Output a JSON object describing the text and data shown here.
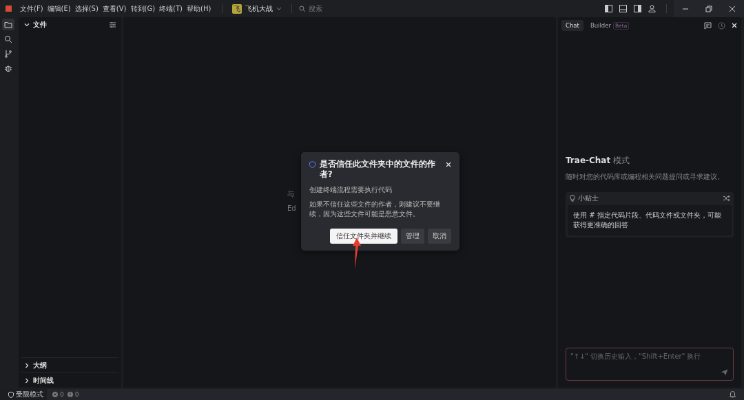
{
  "menu": [
    "文件(F)",
    "编辑(E)",
    "选择(S)",
    "查看(V)",
    "转到(G)",
    "终端(T)",
    "帮助(H)"
  ],
  "project": {
    "initial": "飞",
    "name": "飞机大战"
  },
  "search": {
    "placeholder": "搜索"
  },
  "activity": [
    {
      "kind": "files",
      "selected": true
    },
    {
      "kind": "search",
      "selected": false
    },
    {
      "kind": "branch",
      "selected": false
    },
    {
      "kind": "debug",
      "selected": false
    }
  ],
  "sidebar": {
    "sections": [
      {
        "title": "文件",
        "expanded": true
      },
      {
        "title": "大纲",
        "expanded": false
      },
      {
        "title": "时间线",
        "expanded": false
      }
    ]
  },
  "editor_hints": [
    "与",
    "Ed"
  ],
  "dialog": {
    "title": "是否信任此文件夹中的文件的作者?",
    "subtitle": "创建终端流程需要执行代码",
    "body": "如果不信任这些文件的作者，则建议不要继续，因为这些文件可能是恶意文件。",
    "buttons": [
      {
        "label": "信任文件夹并继续",
        "primary": true
      },
      {
        "label": "管理",
        "primary": false
      },
      {
        "label": "取消",
        "primary": false
      }
    ]
  },
  "chat": {
    "tabs": [
      {
        "label": "Chat",
        "selected": true
      },
      {
        "label": "Builder",
        "selected": false,
        "badge": "Beta"
      }
    ],
    "heading": "Trae-Chat",
    "heading_suffix": "模式",
    "subtitle": "随时对您的代码库或编程相关问题提问或寻求建议。",
    "tip": {
      "title": "小贴士",
      "text": "使用 # 指定代码片段、代码文件或文件夹，可能获得更准确的回答"
    },
    "input": {
      "placeholder": "\"↑↓\" 切换历史输入，\"Shift+Enter\" 换行"
    }
  },
  "status_bar": {
    "mode": "受限模式",
    "errors": "0",
    "warnings": "0"
  }
}
